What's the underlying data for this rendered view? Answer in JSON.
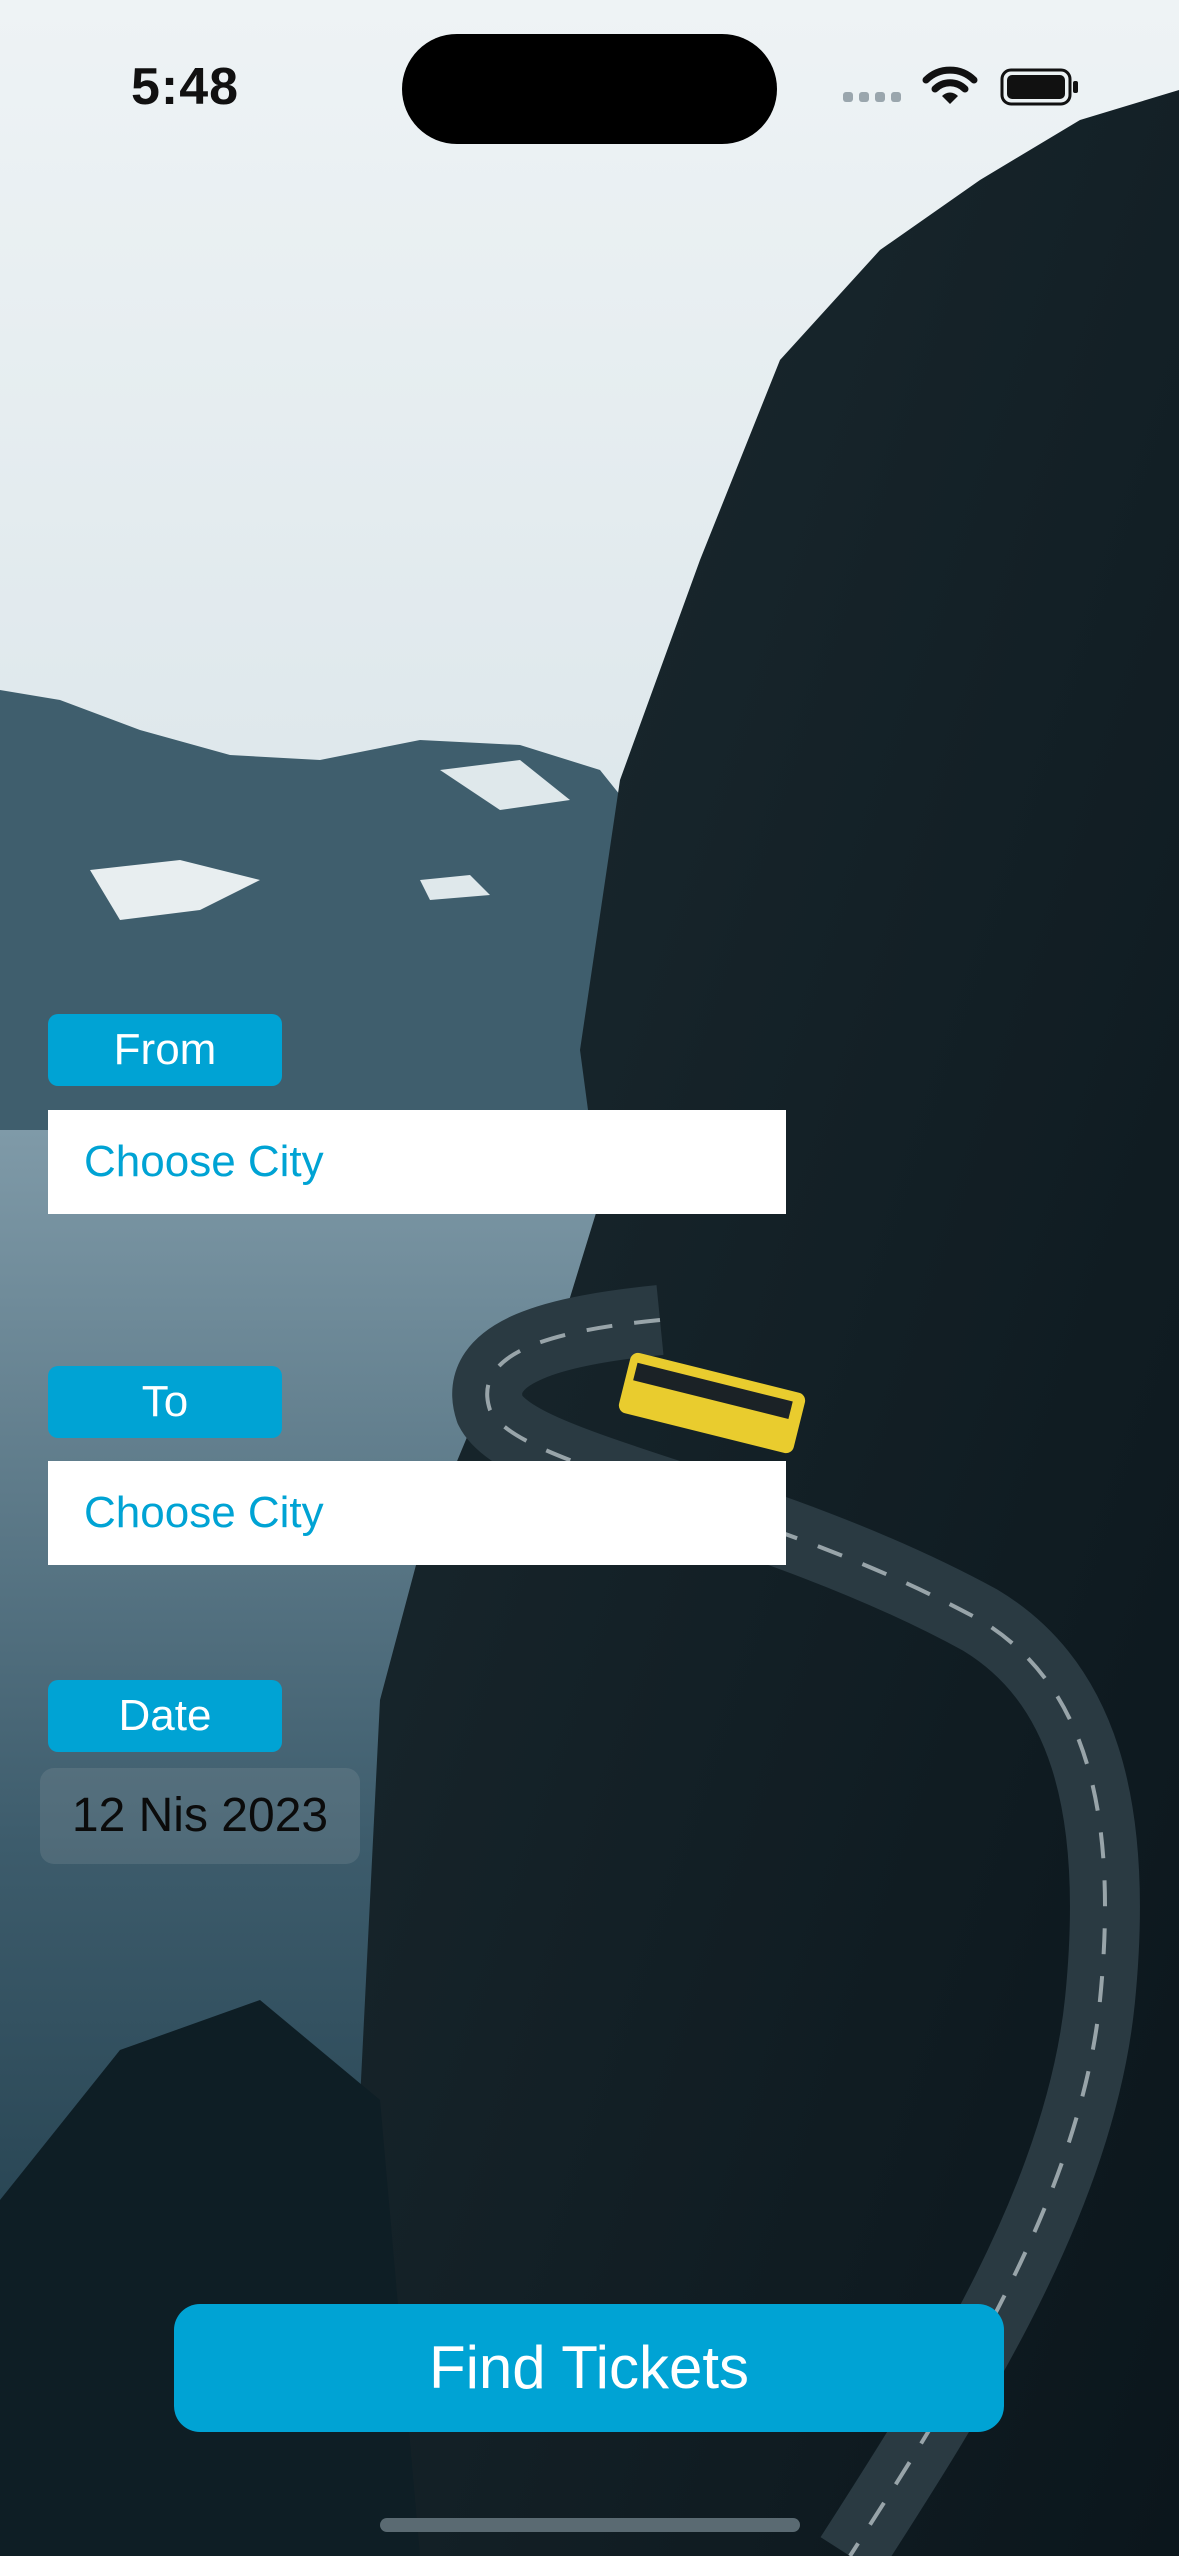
{
  "status_bar": {
    "time": "5:48"
  },
  "form": {
    "from_label": "From",
    "from_value": "Choose City",
    "to_label": "To",
    "to_value": "Choose City",
    "date_label": "Date",
    "date_value": "12 Nis 2023"
  },
  "actions": {
    "find_label": "Find Tickets"
  },
  "colors": {
    "accent": "#00a3d4",
    "field_bg": "#ffffff",
    "text_dark": "#0b0b0b"
  }
}
